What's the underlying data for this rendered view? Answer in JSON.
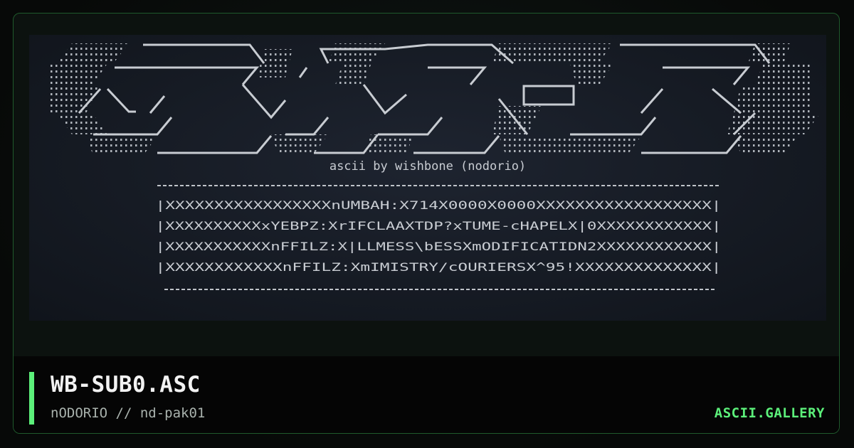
{
  "card": {
    "title": "WB-SUB0.ASC",
    "subtitle": "nODORIO // nd-pak01",
    "brand": "ASCII.GALLERY"
  },
  "art": {
    "caption": "ascii by wishbone (nodorio)",
    "lines": [
      "|XXXXXXXXXXXXXXXXXnUMBAH:X714X0000X0000XXXXXXXXXXXXXXXXXX|",
      "|XXXXXXXXXXxYEBPZ:XrIFCLAAXTDP?xTUME-cHAPELX|0XXXXXXXXXXXX|",
      "|XXXXXXXXXXXnFFILZ:X|LLMESS\\bESSXmODIFICATIDN2XXXXXXXXXXXX|",
      "|XXXXXXXXXXXXnFFILZ:XmIMISTRY/cOURIERSX^95!XXXXXXXXXXXXXX|"
    ]
  },
  "colors": {
    "accent": "#5cf07a",
    "card_border": "#1f5a2c",
    "preview_bg": "#161b24",
    "art_fg": "#c9cdd3"
  }
}
